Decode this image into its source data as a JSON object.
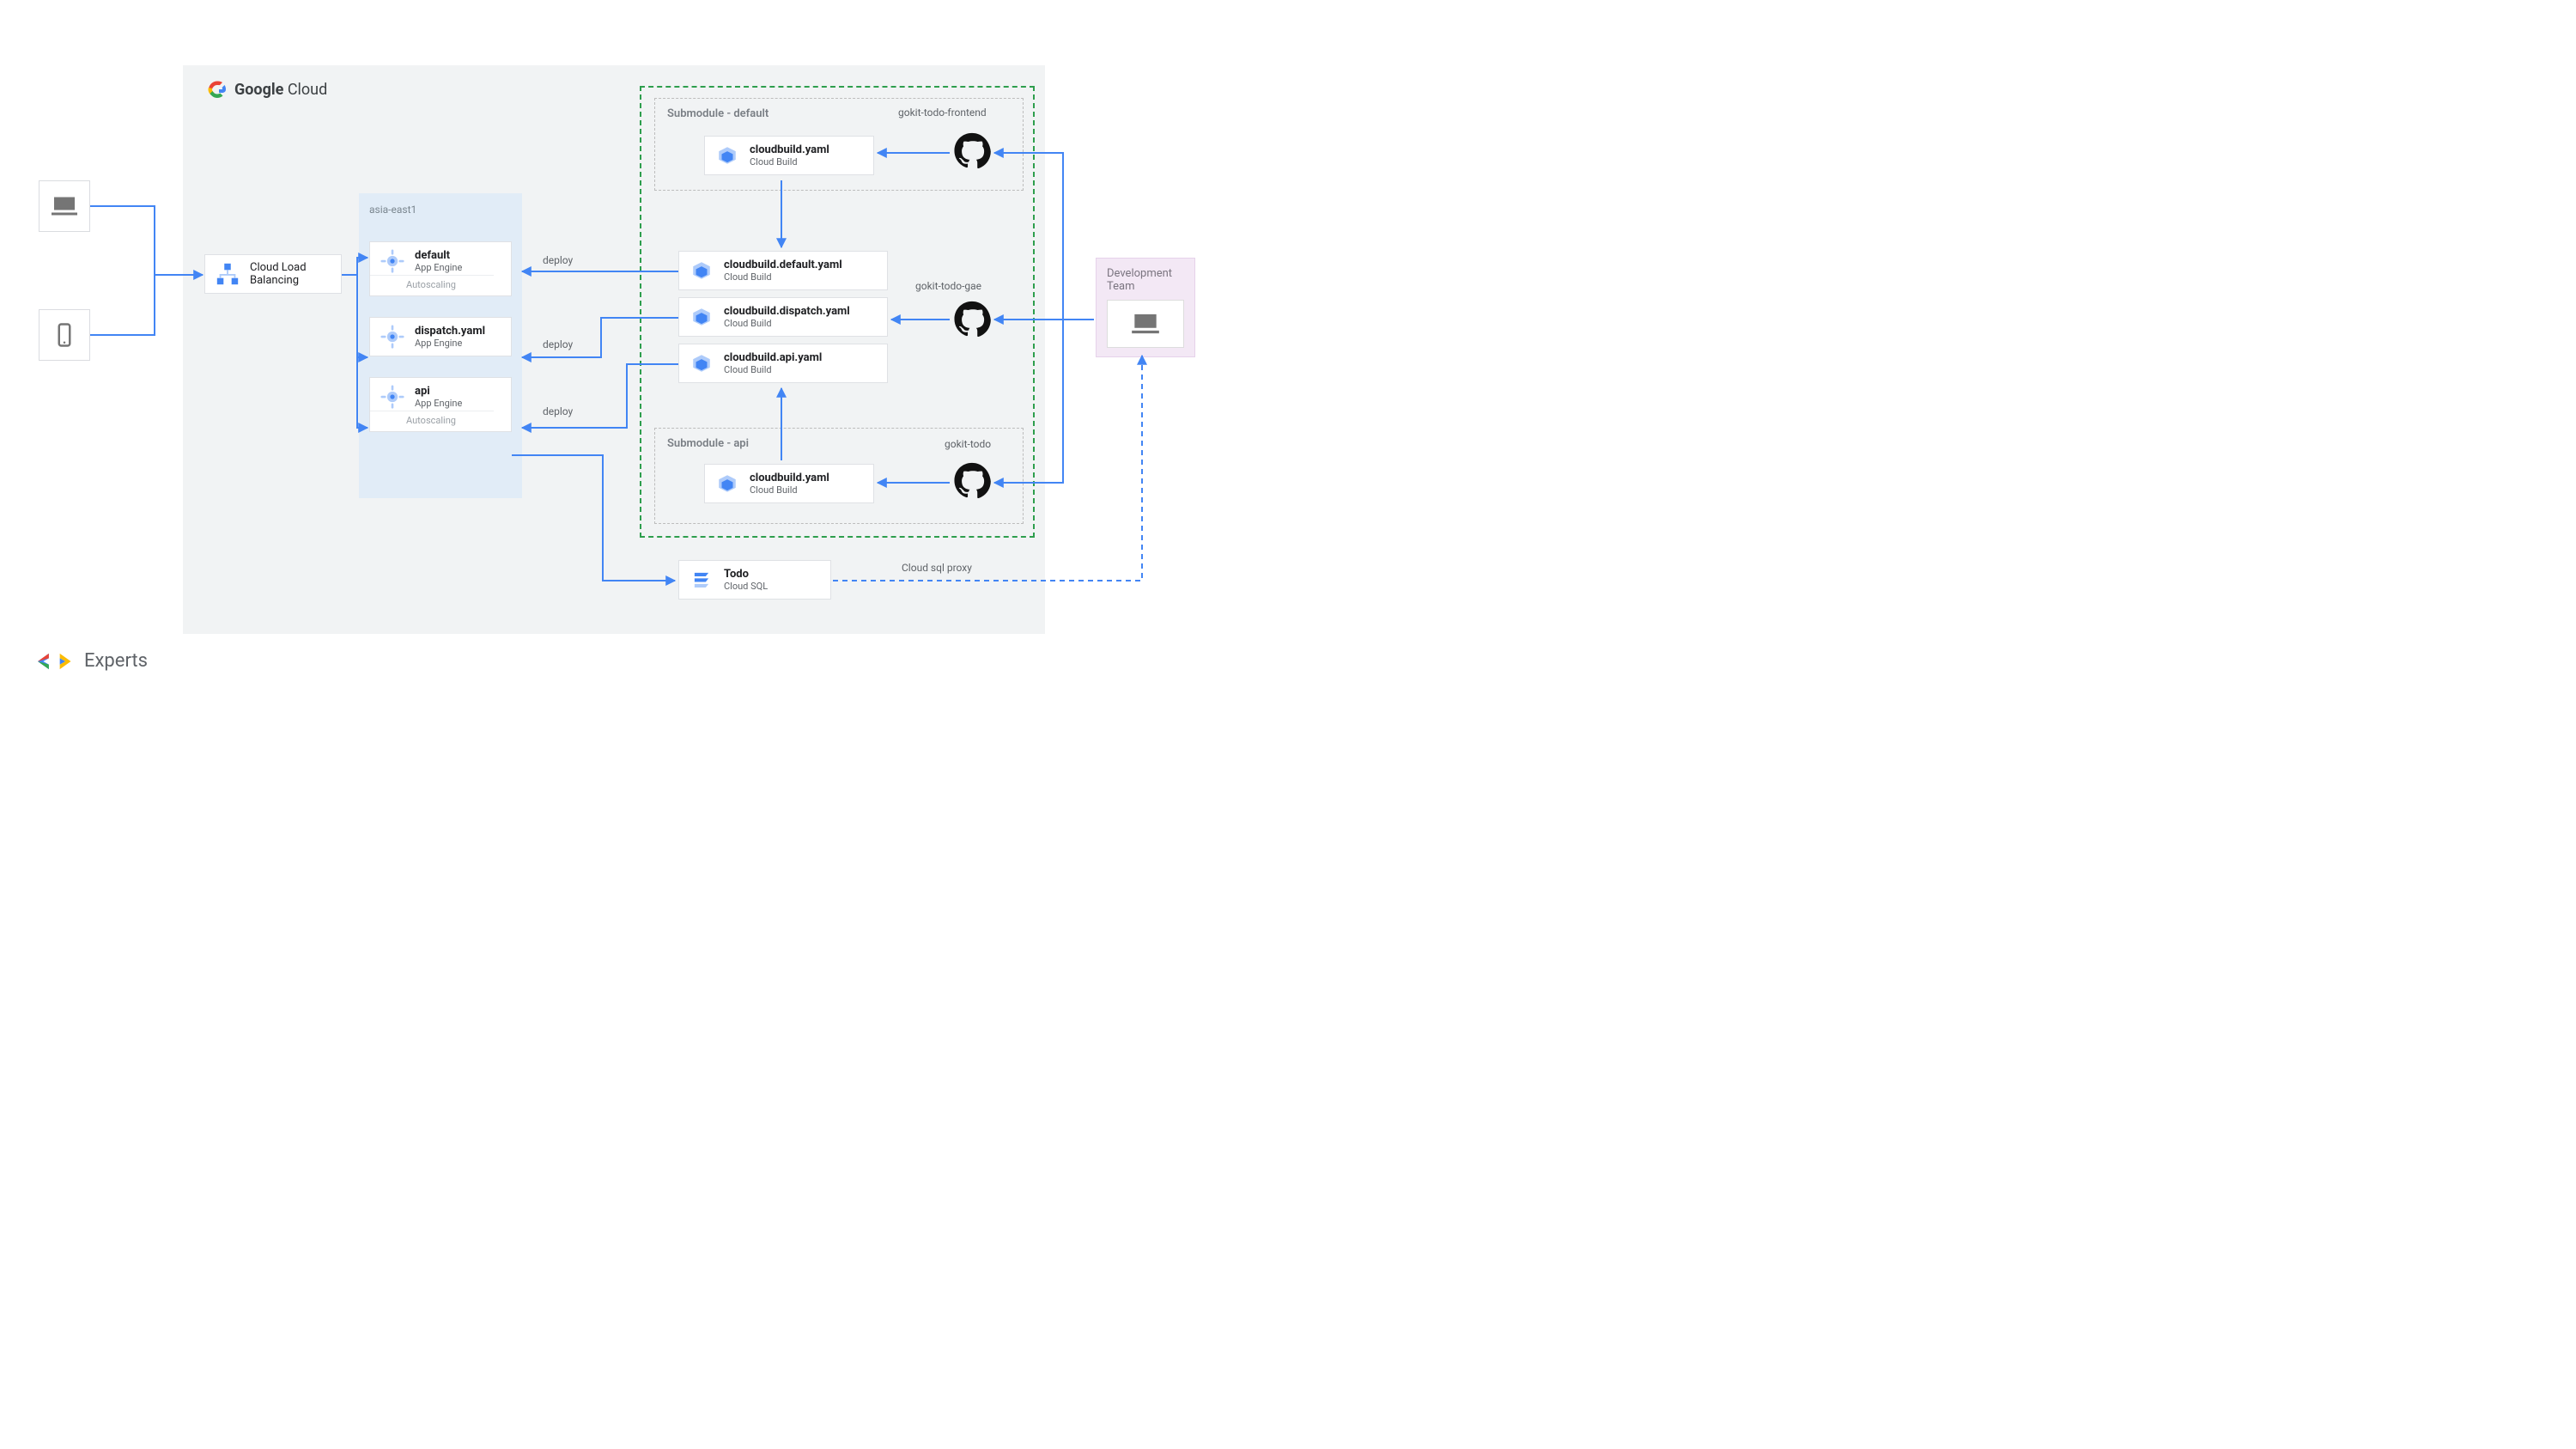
{
  "cloud": {
    "brand_strong": "Google",
    "brand_light": "Cloud"
  },
  "footer": {
    "label": "Experts"
  },
  "clients": {
    "laptop": "laptop-icon",
    "mobile": "mobile-icon"
  },
  "load_balancer": {
    "title": "Cloud Load",
    "subtitle": "Balancing"
  },
  "region": {
    "label": "asia-east1",
    "default": {
      "title": "default",
      "sub": "App Engine",
      "autoscale": "Autoscaling"
    },
    "dispatch": {
      "title": "dispatch.yaml",
      "sub": "App Engine"
    },
    "api": {
      "title": "api",
      "sub": "App Engine",
      "autoscale": "Autoscaling"
    }
  },
  "submodule_default": {
    "label": "Submodule - default",
    "build": {
      "title": "cloudbuild.yaml",
      "sub": "Cloud Build"
    },
    "repo_label": "gokit-todo-frontend"
  },
  "builds_center": {
    "default": {
      "title": "cloudbuild.default.yaml",
      "sub": "Cloud Build"
    },
    "dispatch": {
      "title": "cloudbuild.dispatch.yaml",
      "sub": "Cloud Build"
    },
    "api": {
      "title": "cloudbuild.api.yaml",
      "sub": "Cloud Build"
    },
    "repo_label": "gokit-todo-gae"
  },
  "submodule_api": {
    "label": "Submodule - api",
    "build": {
      "title": "cloudbuild.yaml",
      "sub": "Cloud Build"
    },
    "repo_label": "gokit-todo"
  },
  "database": {
    "title": "Todo",
    "sub": "Cloud SQL"
  },
  "dev_team": {
    "label": "Development",
    "sub": "Team"
  },
  "edges": {
    "deploy1": "deploy",
    "deploy2": "deploy",
    "deploy3": "deploy",
    "sqlproxy": "Cloud sql proxy"
  }
}
